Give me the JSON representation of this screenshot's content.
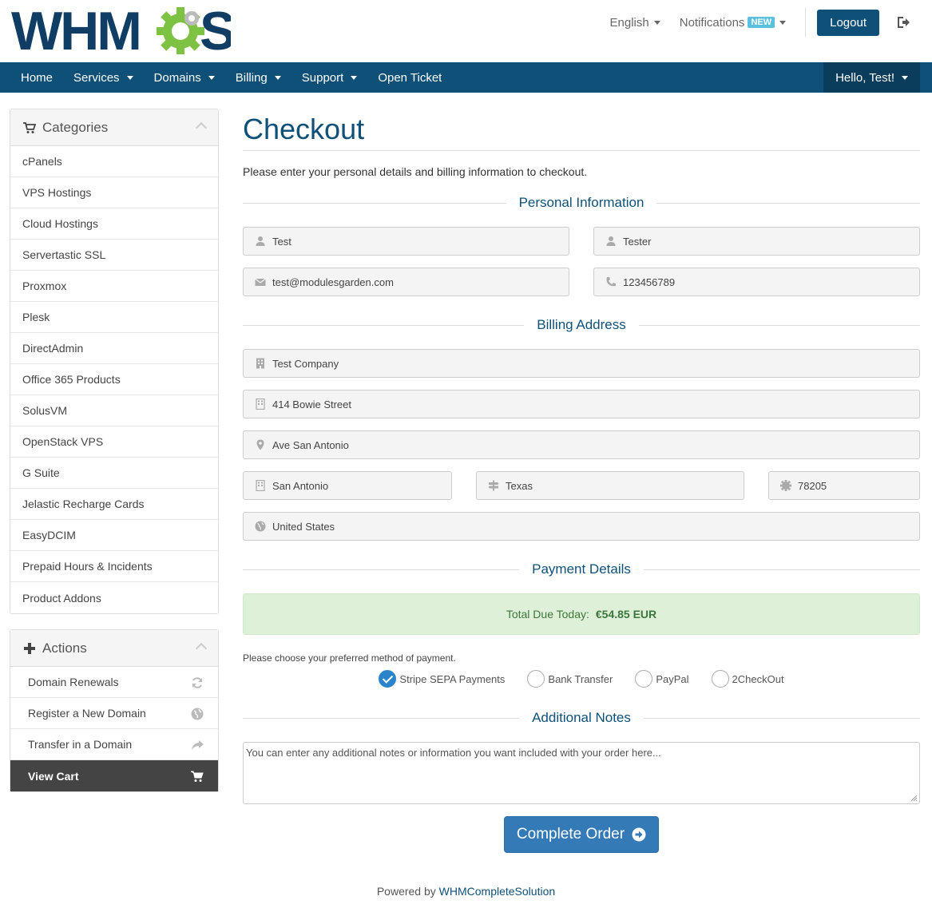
{
  "header": {
    "brand": "WHMCS",
    "language": "English",
    "notifications": "Notifications",
    "notifications_badge": "NEW",
    "logout": "Logout"
  },
  "nav": {
    "items": [
      {
        "label": "Home",
        "dropdown": false
      },
      {
        "label": "Services",
        "dropdown": true
      },
      {
        "label": "Domains",
        "dropdown": true
      },
      {
        "label": "Billing",
        "dropdown": true
      },
      {
        "label": "Support",
        "dropdown": true
      },
      {
        "label": "Open Ticket",
        "dropdown": false
      }
    ],
    "user": "Hello, Test!"
  },
  "sidebar": {
    "categories_title": "Categories",
    "categories": [
      "cPanels",
      "VPS Hostings",
      "Cloud Hostings",
      "Servertastic SSL",
      "Proxmox",
      "Plesk",
      "DirectAdmin",
      "Office 365 Products",
      "SolusVM",
      "OpenStack VPS",
      "G Suite",
      "Jelastic Recharge Cards",
      "EasyDCIM",
      "Prepaid Hours & Incidents",
      "Product Addons"
    ],
    "actions_title": "Actions",
    "actions": [
      {
        "label": "Domain Renewals",
        "icon": "refresh-icon"
      },
      {
        "label": "Register a New Domain",
        "icon": "globe-icon"
      },
      {
        "label": "Transfer in a Domain",
        "icon": "share-icon"
      },
      {
        "label": "View Cart",
        "icon": "cart-icon"
      }
    ]
  },
  "main": {
    "title": "Checkout",
    "intro": "Please enter your personal details and billing information to checkout.",
    "personal_title": "Personal Information",
    "first_name": "Test",
    "last_name": "Tester",
    "email": "test@modulesgarden.com",
    "phone": "123456789",
    "billing_title": "Billing Address",
    "company": "Test Company",
    "address1": "414 Bowie Street",
    "address2": "Ave San Antonio",
    "city": "San Antonio",
    "state": "Texas",
    "postcode": "78205",
    "country": "United States",
    "payment_title": "Payment Details",
    "total_label": "Total Due Today:",
    "total_value": "€54.85 EUR",
    "payment_prompt": "Please choose your preferred method of payment.",
    "payment_methods": [
      {
        "label": "Stripe SEPA Payments",
        "checked": true
      },
      {
        "label": "Bank Transfer",
        "checked": false
      },
      {
        "label": "PayPal",
        "checked": false
      },
      {
        "label": "2CheckOut",
        "checked": false
      }
    ],
    "notes_title": "Additional Notes",
    "notes_placeholder": "You can enter any additional notes or information you want included with your order here...",
    "complete_button": "Complete Order"
  },
  "footer": {
    "powered_by": "Powered by",
    "link": "WHMCompleteSolution"
  },
  "colors": {
    "brand": "#0e5077",
    "accent_green": "#7dc242",
    "success_bg": "#dff0d8",
    "button_primary": "#337ab7"
  }
}
